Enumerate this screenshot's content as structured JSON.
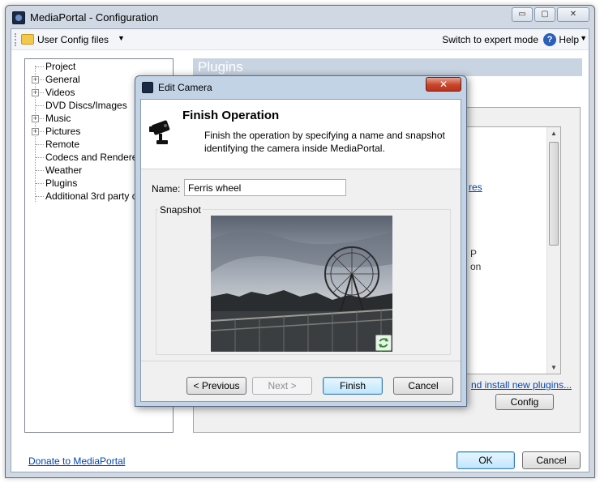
{
  "window": {
    "title": "MediaPortal - Configuration",
    "minimize": "▭",
    "maximize": "▢",
    "close": "✕"
  },
  "toolbar": {
    "user_config": "User Config files",
    "expert_mode": "Switch to expert mode",
    "help": "Help",
    "help_icon_glyph": "?"
  },
  "tree": {
    "items": [
      {
        "label": "Project",
        "expandable": false
      },
      {
        "label": "General",
        "expandable": true
      },
      {
        "label": "Videos",
        "expandable": true
      },
      {
        "label": "DVD Discs/Images",
        "expandable": false
      },
      {
        "label": "Music",
        "expandable": true
      },
      {
        "label": "Pictures",
        "expandable": true
      },
      {
        "label": "Remote",
        "expandable": false
      },
      {
        "label": "Codecs and Renderer",
        "expandable": false
      },
      {
        "label": "Weather",
        "expandable": false
      },
      {
        "label": "Plugins",
        "expandable": false
      },
      {
        "label": "Additional 3rd party che",
        "expandable": false
      }
    ]
  },
  "plugins_panel": {
    "title": "Plugins",
    "partial_texts": [
      "res",
      "P",
      "on"
    ],
    "install_link": "nd install new plugins...",
    "config_button": "Config"
  },
  "footer": {
    "donate_link": "Donate to MediaPortal",
    "ok": "OK",
    "cancel": "Cancel"
  },
  "dialog": {
    "title": "Edit Camera",
    "close": "✕",
    "heading": "Finish Operation",
    "description": "Finish the operation by specifying a name and snapshot identifying the camera inside MediaPortal.",
    "name_label": "Name:",
    "name_value": "Ferris wheel",
    "snapshot_label": "Snapshot",
    "previous_button": "< Previous",
    "next_button": "Next >",
    "finish_button": "Finish",
    "cancel_button": "Cancel"
  },
  "colors": {
    "link": "#0645ad",
    "primary_button": "#bee6fd",
    "dialog_close": "#c8452b"
  }
}
